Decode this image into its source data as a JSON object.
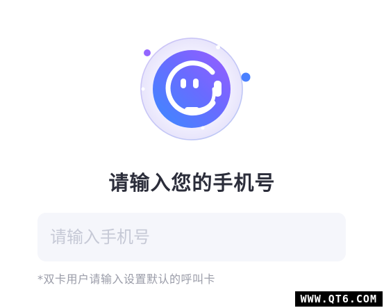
{
  "logo": {
    "icon": "customer-service-robot-icon",
    "colors": {
      "gradient_start": "#3a8bff",
      "gradient_end": "#9b5cff",
      "dot_blue": "#4a80ff",
      "dot_purple": "#9466ff"
    }
  },
  "title": "请输入您的手机号",
  "phone_input": {
    "value": "",
    "placeholder": "请输入手机号"
  },
  "hint": "*双卡用户请输入设置默认的呼叫卡",
  "watermark": "WWW.QT6.COM"
}
